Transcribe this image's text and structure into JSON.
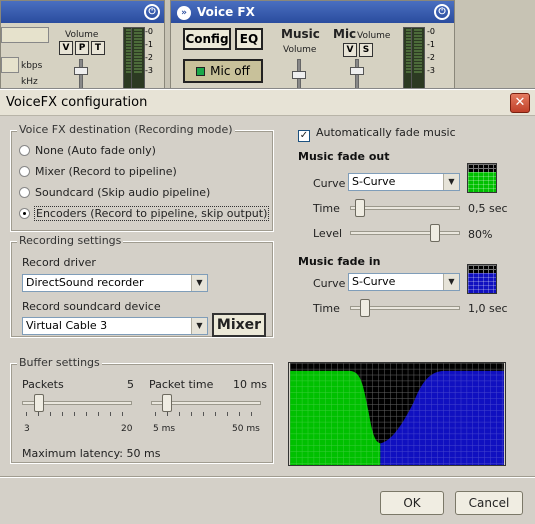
{
  "background_app": {
    "left_panel": {
      "volume_label": "Volume",
      "buttons": [
        "V",
        "P",
        "T"
      ],
      "kbps_label": "kbps",
      "khz_label": "kHz",
      "scale": [
        "-0",
        "-1",
        "-2",
        "-3"
      ]
    },
    "voicefx_panel": {
      "title": "Voice FX",
      "config_button": "Config",
      "eq_button": "EQ",
      "mic_off_button": "Mic off",
      "music_label": "Music",
      "music_volume_label": "Volume",
      "mic_label": "Mic",
      "mic_volume_label": "Volume",
      "buttons": [
        "V",
        "S"
      ],
      "scale": [
        "-0",
        "-1",
        "-2",
        "-3"
      ]
    }
  },
  "dialog": {
    "title": "VoiceFX configuration",
    "destination": {
      "group_label": "Voice FX destination (Recording mode)",
      "options": [
        {
          "label": "None (Auto fade only)",
          "selected": false
        },
        {
          "label": "Mixer (Record to pipeline)",
          "selected": false
        },
        {
          "label": "Soundcard (Skip audio pipeline)",
          "selected": false
        },
        {
          "label": "Encoders (Record to pipeline, skip output)",
          "selected": true
        }
      ]
    },
    "recording": {
      "group_label": "Recording settings",
      "driver_label": "Record driver",
      "driver_value": "DirectSound recorder",
      "device_label": "Record soundcard device",
      "device_value": "Virtual Cable 3",
      "mixer_button": "Mixer"
    },
    "buffer": {
      "group_label": "Buffer settings",
      "packets_label": "Packets",
      "packets_value": "5",
      "packets_min": "3",
      "packets_max": "20",
      "packets_position": 0.12,
      "packet_time_label": "Packet time",
      "packet_time_value": "10 ms",
      "packet_time_min": "5 ms",
      "packet_time_max": "50 ms",
      "packet_time_position": 0.11,
      "latency_label": "Maximum latency: 50 ms"
    },
    "auto_fade": {
      "label": "Automatically fade music",
      "checked": true
    },
    "fade_out": {
      "title": "Music fade out",
      "curve_label": "Curve",
      "curve_value": "S-Curve",
      "time_label": "Time",
      "time_value": "0,5 sec",
      "time_position": 0.05,
      "level_label": "Level",
      "level_value": "80%",
      "level_position": 0.8,
      "preview_color": "#00c000"
    },
    "fade_in": {
      "title": "Music fade in",
      "curve_label": "Curve",
      "curve_value": "S-Curve",
      "time_label": "Time",
      "time_value": "1,0 sec",
      "time_position": 0.1,
      "preview_color": "#1010c0"
    },
    "graph": {
      "fade_out_color": "#00c000",
      "fade_in_color": "#1010c0",
      "background": "#000000"
    },
    "ok_button": "OK",
    "cancel_button": "Cancel"
  }
}
